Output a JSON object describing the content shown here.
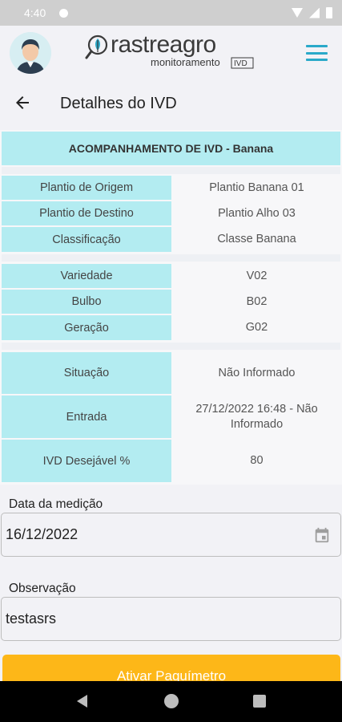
{
  "status_bar": {
    "time": "4:40"
  },
  "header": {
    "logo_main": "rastreagro",
    "logo_sub": "monitoramento",
    "logo_badge": "IVD"
  },
  "page": {
    "title": "Detalhes do IVD"
  },
  "section": {
    "title": "ACOMPANHAMENTO DE IVD - Banana"
  },
  "group1": [
    {
      "label": "Plantio de Origem",
      "value": "Plantio Banana 01"
    },
    {
      "label": "Plantio de Destino",
      "value": "Plantio Alho 03"
    },
    {
      "label": "Classificação",
      "value": "Classe Banana"
    }
  ],
  "group2": [
    {
      "label": "Variedade",
      "value": "V02"
    },
    {
      "label": "Bulbo",
      "value": "B02"
    },
    {
      "label": "Geração",
      "value": "G02"
    }
  ],
  "group3": [
    {
      "label": "Situação",
      "value": "Não Informado"
    },
    {
      "label": "Entrada",
      "value": "27/12/2022 16:48 - Não Informado"
    },
    {
      "label": "IVD Desejável %",
      "value": "80"
    }
  ],
  "form": {
    "date_label": "Data da medição",
    "date_value": "16/12/2022",
    "obs_label": "Observação",
    "obs_value": "testasrs",
    "button_label": "Ativar Paquímetro"
  },
  "colors": {
    "accent": "#2aa9c9",
    "table_label_bg": "#b3ecf1",
    "button": "#fdb718"
  }
}
